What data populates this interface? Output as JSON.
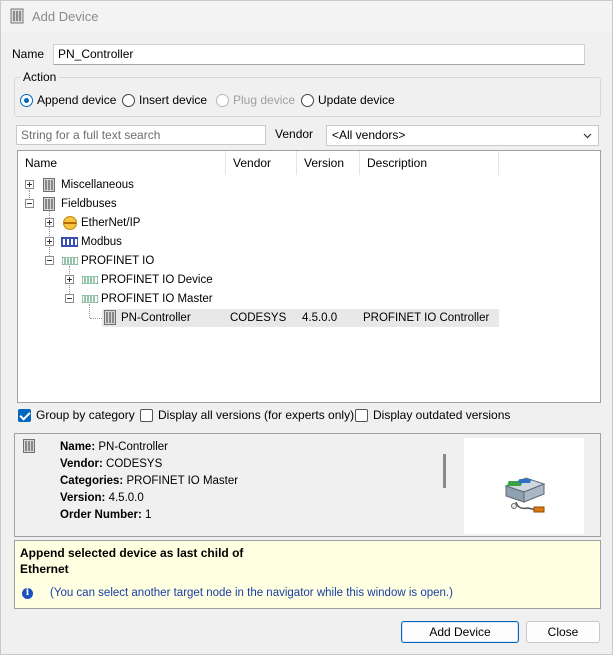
{
  "window": {
    "title": "Add Device"
  },
  "name_field": {
    "label": "Name",
    "value": "PN_Controller"
  },
  "action": {
    "title": "Action",
    "options": [
      {
        "label": "Append device",
        "selected": true,
        "enabled": true
      },
      {
        "label": "Insert device",
        "selected": false,
        "enabled": true
      },
      {
        "label": "Plug device",
        "selected": false,
        "enabled": false
      },
      {
        "label": "Update device",
        "selected": false,
        "enabled": true
      }
    ]
  },
  "search": {
    "placeholder": "String for a full text search"
  },
  "vendor": {
    "label": "Vendor",
    "selected": "<All vendors>"
  },
  "tree": {
    "columns": [
      "Name",
      "Vendor",
      "Version",
      "Description"
    ],
    "rows": [
      {
        "name": "Miscellaneous",
        "vendor": "",
        "version": "",
        "description": "",
        "icon": "device-icon",
        "expander": "plus"
      },
      {
        "name": "Fieldbuses",
        "vendor": "",
        "version": "",
        "description": "",
        "icon": "device-icon",
        "expander": "minus"
      },
      {
        "name": "EtherNet/IP",
        "vendor": "",
        "version": "",
        "description": "",
        "icon": "ethernet-ip-icon",
        "expander": "plus"
      },
      {
        "name": "Modbus",
        "vendor": "",
        "version": "",
        "description": "",
        "icon": "modbus-icon",
        "expander": "plus"
      },
      {
        "name": "PROFINET IO",
        "vendor": "",
        "version": "",
        "description": "",
        "icon": "profinet-icon",
        "expander": "minus"
      },
      {
        "name": "PROFINET IO Device",
        "vendor": "",
        "version": "",
        "description": "",
        "icon": "profinet-icon",
        "expander": "plus"
      },
      {
        "name": "PROFINET IO Master",
        "vendor": "",
        "version": "",
        "description": "",
        "icon": "profinet-icon",
        "expander": "minus"
      },
      {
        "name": "PN-Controller",
        "vendor": "CODESYS",
        "version": "4.5.0.0",
        "description": "PROFINET IO Controller",
        "icon": "device-icon",
        "expander": "none",
        "selected": true
      }
    ]
  },
  "options": {
    "group_by_category": {
      "label": "Group by category",
      "checked": true
    },
    "display_all_versions": {
      "label": "Display all versions (for experts only)",
      "checked": false
    },
    "display_outdated": {
      "label": "Display outdated versions",
      "checked": false
    }
  },
  "details": {
    "name_label": "Name:",
    "name": "PN-Controller",
    "vendor_label": "Vendor:",
    "vendor": "CODESYS",
    "categories_label": "Categories:",
    "categories": "PROFINET IO Master",
    "version_label": "Version:",
    "version": "4.5.0.0",
    "order_label": "Order Number:",
    "order": "1"
  },
  "message": {
    "line1": "Append selected device as last child of",
    "line2": "Ethernet",
    "note": "(You can select another target node in the navigator while this window is open.)"
  },
  "buttons": {
    "add": "Add Device",
    "close": "Close"
  },
  "colors": {
    "accent": "#0067c0",
    "message_bg": "#ffffe1",
    "note_text": "#1a3ea8"
  }
}
